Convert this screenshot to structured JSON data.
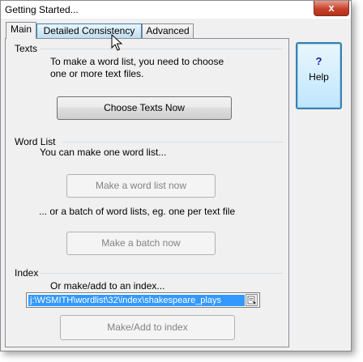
{
  "window": {
    "title": "Getting Started...",
    "close_label": "x"
  },
  "tabs": [
    {
      "label": "Main",
      "state": "active"
    },
    {
      "label": "Detailed Consistency",
      "state": "hover"
    },
    {
      "label": "Advanced",
      "state": "normal"
    }
  ],
  "texts": {
    "heading": "Texts",
    "description_line1": "To make a word list, you need to choose",
    "description_line2": "one or more text files.",
    "choose_button": "Choose Texts Now"
  },
  "word_list": {
    "heading": "Word List",
    "intro": "You can make one word list...",
    "make_button": "Make a word list now",
    "batch_text": "... or a batch of word lists, eg. one per text file",
    "batch_button": "Make a batch now"
  },
  "index": {
    "heading": "Index",
    "intro": "Or make/add to an index...",
    "path_value": "j:\\WSMITH\\wordlist\\32\\index\\shakespeare_plays",
    "make_button": "Make/Add to index"
  },
  "help": {
    "symbol": "?",
    "label": "Help"
  },
  "colors": {
    "selection": "#3399ff",
    "hover_border": "#3c7fb1",
    "close": "#c7422b"
  }
}
